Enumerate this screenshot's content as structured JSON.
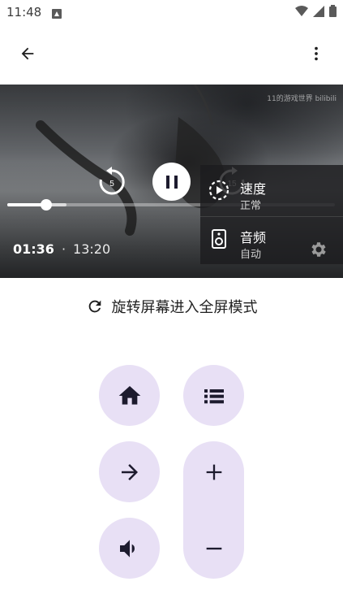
{
  "status_bar": {
    "time": "11:48"
  },
  "video": {
    "watermark": "11的游戏世界 bilibili",
    "replay_seconds": "5",
    "forward_seconds": "15",
    "progress_fraction": 0.12,
    "buffer_fraction": 0.18,
    "current_time": "01:36",
    "separator": "·",
    "duration": "13:20",
    "panel": {
      "speed_label": "速度",
      "speed_value": "正常",
      "audio_label": "音频",
      "audio_value": "自动"
    }
  },
  "rotate_hint": "旋转屏幕进入全屏模式",
  "colors": {
    "pad": "#e8e0f5",
    "icon": "#1d1b2e"
  }
}
